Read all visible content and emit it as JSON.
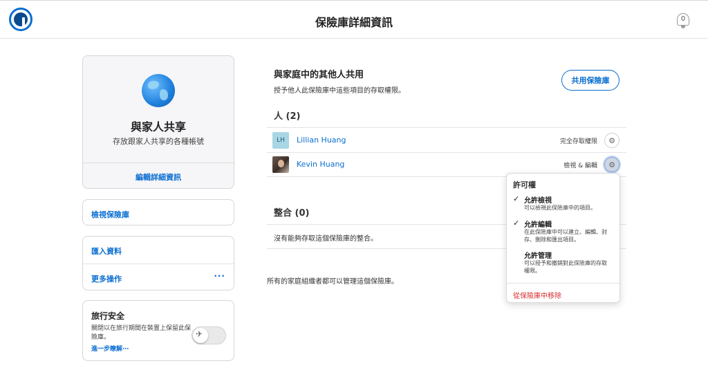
{
  "header": {
    "title": "保險庫詳細資訊",
    "notification_count": "0"
  },
  "vault": {
    "name": "與家人共享",
    "description": "存放跟家人共享的各種帳號",
    "edit_label": "編輯詳細資訊"
  },
  "sidebar": {
    "view_vault": "檢視保險庫",
    "import": "匯入資料",
    "more_actions": "更多操作",
    "more_dots": "···"
  },
  "travel": {
    "title": "旅行安全",
    "description": "關閉以在旅行期間在裝置上保留此保險庫。",
    "learn_more": "進一步瞭解⋯",
    "enabled": false
  },
  "share": {
    "title": "與家庭中的其他人共用",
    "subtitle": "授予他人此保險庫中這些項目的存取權限。",
    "button": "共用保險庫"
  },
  "people": {
    "heading": "人 (2)",
    "rows": [
      {
        "initials": "LH",
        "name": "Lillian Huang",
        "permission": "完全存取權限"
      },
      {
        "initials": "",
        "name": "Kevin Huang",
        "permission": "檢視 & 編輯"
      }
    ]
  },
  "integrations": {
    "heading": "整合 (0)",
    "empty": "沒有能夠存取這個保險庫的整合。"
  },
  "footer_note": "所有的家庭組織者都可以管理這個保險庫。",
  "popover": {
    "heading": "許可權",
    "options": [
      {
        "check": "✓",
        "label": "允許檢視",
        "desc": "可以檢視此保險庫中的項目。"
      },
      {
        "check": "✓",
        "label": "允許編輯",
        "desc": "在此保險庫中可以建立、編輯、封存、刪除和匯出項目。"
      },
      {
        "check": "",
        "label": "允許管理",
        "desc": "可以授予和撤銷對此保險庫的存取權限。"
      }
    ],
    "remove": "從保險庫中移除"
  },
  "colors": {
    "accent": "#0a6ed1",
    "danger": "#d62b2b"
  }
}
